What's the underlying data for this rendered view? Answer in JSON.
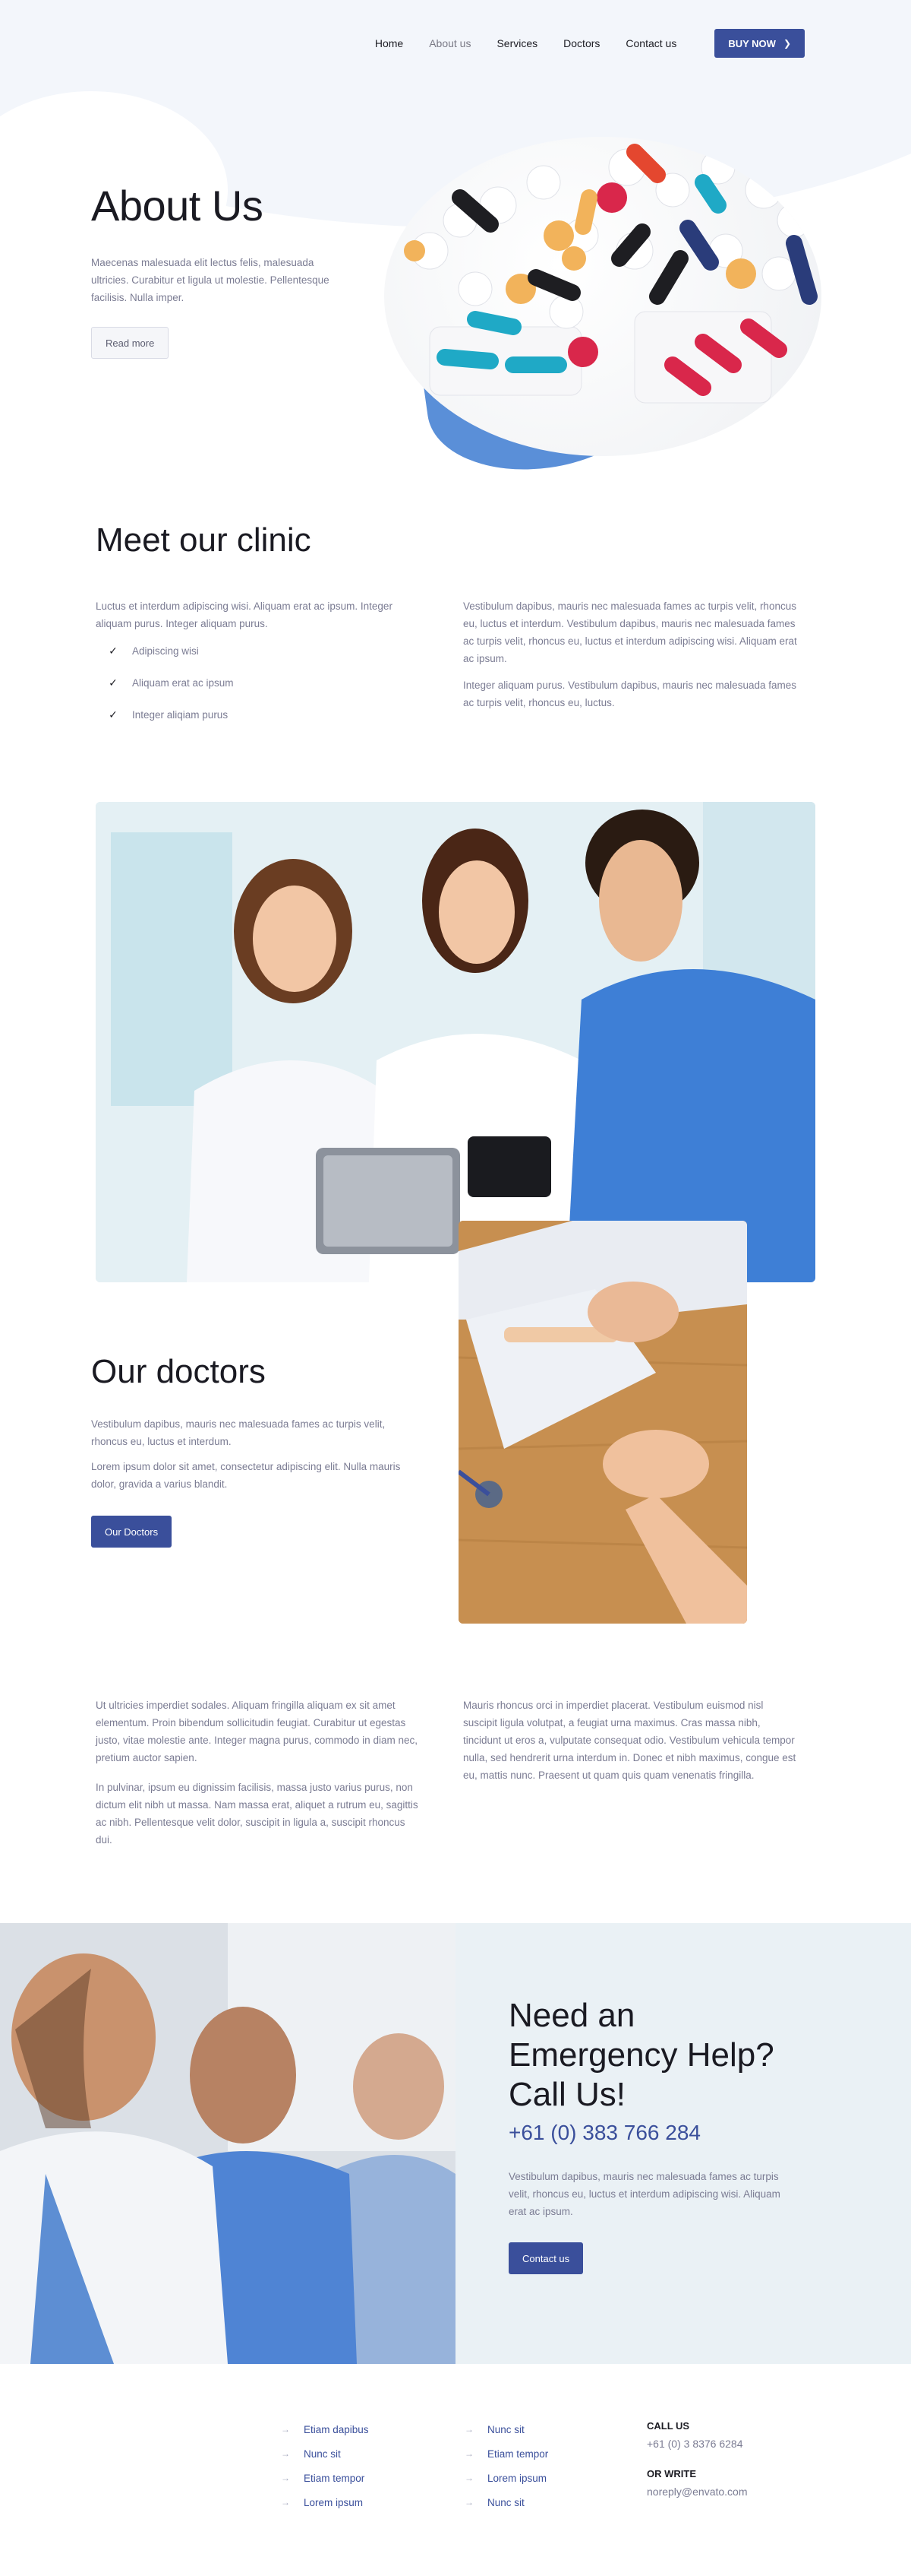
{
  "nav": {
    "items": [
      "Home",
      "About us",
      "Services",
      "Doctors",
      "Contact us"
    ],
    "buy_label": "BUY NOW"
  },
  "hero": {
    "title": "About Us",
    "text": "Maecenas malesuada elit lectus felis, malesuada ultricies. Curabitur et ligula ut molestie. Pellentesque facilisis. Nulla imper.",
    "button": "Read more"
  },
  "clinic": {
    "title": "Meet our clinic",
    "left_text": "Luctus et interdum adipiscing wisi. Aliquam erat ac ipsum. Integer aliquam purus. Integer aliquam purus.",
    "checks": [
      "Adipiscing wisi",
      "Aliquam erat ac ipsum",
      "Integer aliqiam purus"
    ],
    "right_text_1": "Vestibulum dapibus, mauris nec malesuada fames ac turpis velit, rhoncus eu, luctus et interdum. Vestibulum dapibus, mauris nec malesuada fames ac turpis velit, rhoncus eu, luctus et interdum adipiscing wisi. Aliquam erat ac ipsum.",
    "right_text_2": "Integer aliquam purus. Vestibulum dapibus, mauris nec malesuada fames ac turpis velit, rhoncus eu, luctus."
  },
  "doctors": {
    "title": "Our doctors",
    "text_1": "Vestibulum dapibus, mauris nec malesuada fames ac turpis velit, rhoncus eu, luctus et interdum.",
    "text_2": "Lorem ipsum dolor sit amet, consectetur adipiscing elit. Nulla mauris dolor, gravida a varius blandit.",
    "button": "Our Doctors"
  },
  "info": {
    "left_1": "Ut ultricies imperdiet sodales. Aliquam fringilla aliquam ex sit amet elementum. Proin bibendum sollicitudin feugiat. Curabitur ut egestas justo, vitae molestie ante. Integer magna purus, commodo in diam nec, pretium auctor sapien.",
    "left_2": "In pulvinar, ipsum eu dignissim facilisis, massa justo varius purus, non dictum elit nibh ut massa. Nam massa erat, aliquet a rutrum eu, sagittis ac nibh. Pellentesque velit dolor, suscipit in ligula a, suscipit rhoncus dui.",
    "right_1": "Mauris rhoncus orci in imperdiet placerat. Vestibulum euismod nisl suscipit ligula volutpat, a feugiat urna maximus. Cras massa nibh, tincidunt ut eros a, vulputate consequat odio. Vestibulum vehicula tempor nulla, sed hendrerit urna interdum in. Donec et nibh maximus, congue est eu, mattis nunc. Praesent ut quam quis quam venenatis fringilla."
  },
  "emergency": {
    "title_1": "Need an",
    "title_2": "Emergency Help?",
    "title_3": "Call Us!",
    "phone": "+61 (0) 383 766 284",
    "text": "Vestibulum dapibus, mauris nec malesuada fames ac turpis velit, rhoncus eu, luctus et interdum adipiscing wisi. Aliquam erat ac ipsum.",
    "button": "Contact us"
  },
  "footer": {
    "col1": [
      "Etiam dapibus",
      "Nunc sit",
      "Etiam tempor",
      "Lorem ipsum"
    ],
    "col2": [
      "Nunc sit",
      "Etiam tempor",
      "Lorem ipsum",
      "Nunc sit"
    ],
    "call_label": "CALL US",
    "call_value": "+61 (0) 3 8376 6284",
    "write_label": "OR WRITE",
    "write_value": "noreply@envato.com"
  },
  "colors": {
    "brand": "#3a4f9b",
    "muted_text": "#7b7c93",
    "panel_bg": "#eaf1f5"
  },
  "icons": [
    "chevron-right-icon",
    "check-icon",
    "arrow-right-icon"
  ]
}
